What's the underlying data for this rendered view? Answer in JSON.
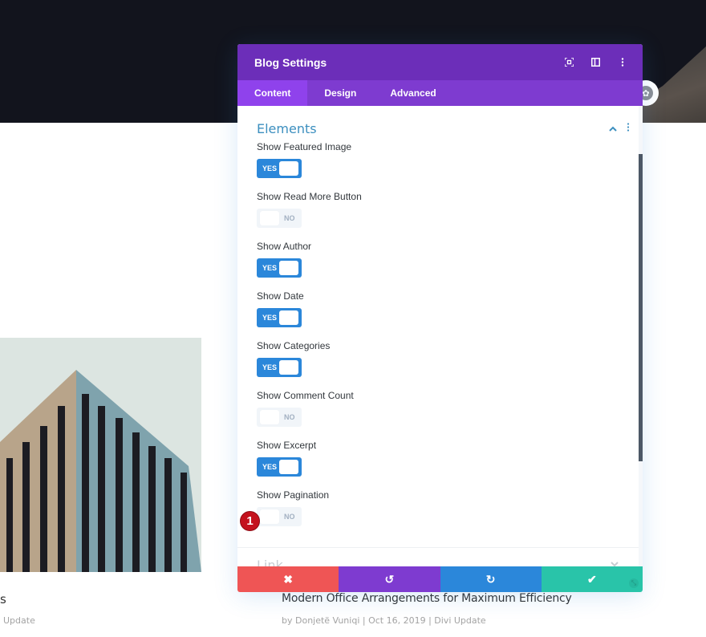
{
  "modal": {
    "title": "Blog Settings",
    "header_icons": [
      "expand-icon",
      "split-view-icon",
      "more-options-icon"
    ],
    "tabs": [
      {
        "label": "Content",
        "active": true
      },
      {
        "label": "Design",
        "active": false
      },
      {
        "label": "Advanced",
        "active": false
      }
    ],
    "section": {
      "title": "Elements",
      "fields": [
        {
          "label": "Show Featured Image",
          "value": "YES"
        },
        {
          "label": "Show Read More Button",
          "value": "NO"
        },
        {
          "label": "Show Author",
          "value": "YES"
        },
        {
          "label": "Show Date",
          "value": "YES"
        },
        {
          "label": "Show Categories",
          "value": "YES"
        },
        {
          "label": "Show Comment Count",
          "value": "NO"
        },
        {
          "label": "Show Excerpt",
          "value": "YES"
        },
        {
          "label": "Show Pagination",
          "value": "NO"
        }
      ]
    },
    "next_section": "Link",
    "step_marker": "1",
    "footer": {
      "cancel": "✖",
      "undo": "↺",
      "redo": "↻",
      "save": "✔"
    }
  },
  "page": {
    "left_post_title_fragment": "s",
    "left_post_meta_fragment": "Update",
    "post_title": "Modern Office Arrangements for Maximum Efficiency",
    "post_meta": "by Donjetë Vuniqi | Oct 16, 2019 | Divi Update"
  },
  "colors": {
    "header": "#6c2eb9",
    "tabs": "#7e3bd0",
    "tab_active": "#8f42ec",
    "toggle_on": "#2b87da",
    "cancel": "#ef5555",
    "undo": "#7e3bd0",
    "redo": "#2b87da",
    "save": "#29c4a9",
    "marker": "#c4111d"
  }
}
